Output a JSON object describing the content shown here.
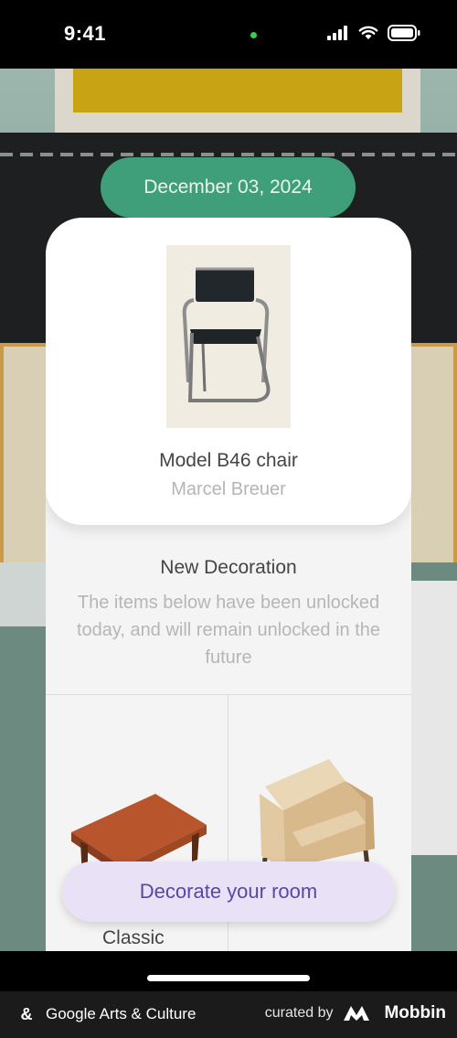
{
  "status_bar": {
    "time": "9:41"
  },
  "date_badge": "December 03, 2024",
  "artwork": {
    "title": "Model B46 chair",
    "artist": "Marcel Breuer"
  },
  "decoration": {
    "heading": "New Decoration",
    "description": "The items below have been unlocked today, and will remain unlocked in the future",
    "items": [
      {
        "label": "Classic"
      },
      {
        "label": ""
      }
    ]
  },
  "cta_label": "Decorate your room",
  "footer": {
    "brand": "Google Arts & Culture",
    "curated_by": "curated by",
    "mobbin": "Mobbin"
  },
  "colors": {
    "date_pill": "#3f9f7a",
    "cta_bg": "#e9e2f6",
    "cta_text": "#5a45a8"
  }
}
